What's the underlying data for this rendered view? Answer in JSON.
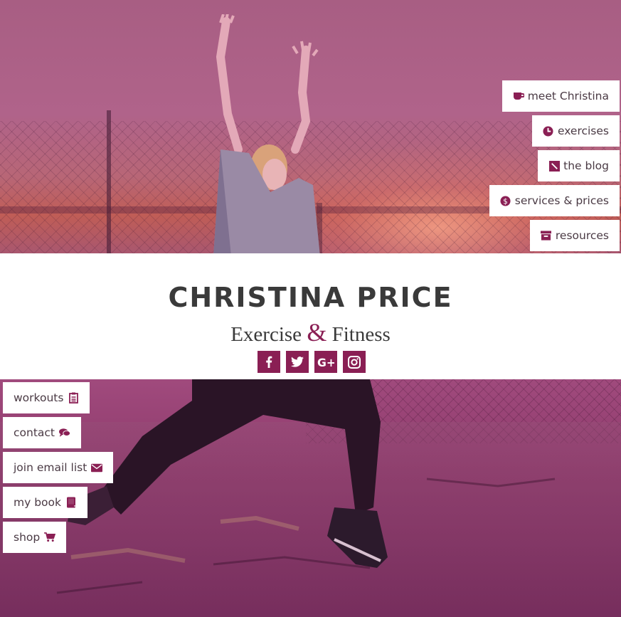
{
  "right_nav": [
    {
      "label": "meet Christina",
      "icon": "coffee-icon"
    },
    {
      "label": "exercises",
      "icon": "clock-icon"
    },
    {
      "label": "the blog",
      "icon": "pencil-icon"
    },
    {
      "label": "services & prices",
      "icon": "dollar-icon"
    },
    {
      "label": "resources",
      "icon": "archive-icon"
    }
  ],
  "brand": {
    "title": "CHRISTINA PRICE",
    "subtitle_left": "Exercise",
    "subtitle_amp": "&",
    "subtitle_right": "Fitness"
  },
  "social": [
    "facebook-icon",
    "twitter-icon",
    "google-plus-icon",
    "instagram-icon"
  ],
  "left_nav": [
    {
      "label": "workouts",
      "icon": "clipboard-icon"
    },
    {
      "label": "contact",
      "icon": "comments-icon"
    },
    {
      "label": "join email list",
      "icon": "envelope-icon"
    },
    {
      "label": "my book",
      "icon": "book-icon"
    },
    {
      "label": "shop",
      "icon": "cart-icon"
    }
  ],
  "colors": {
    "accent": "#8a1f54",
    "text": "#3a3a3a"
  }
}
